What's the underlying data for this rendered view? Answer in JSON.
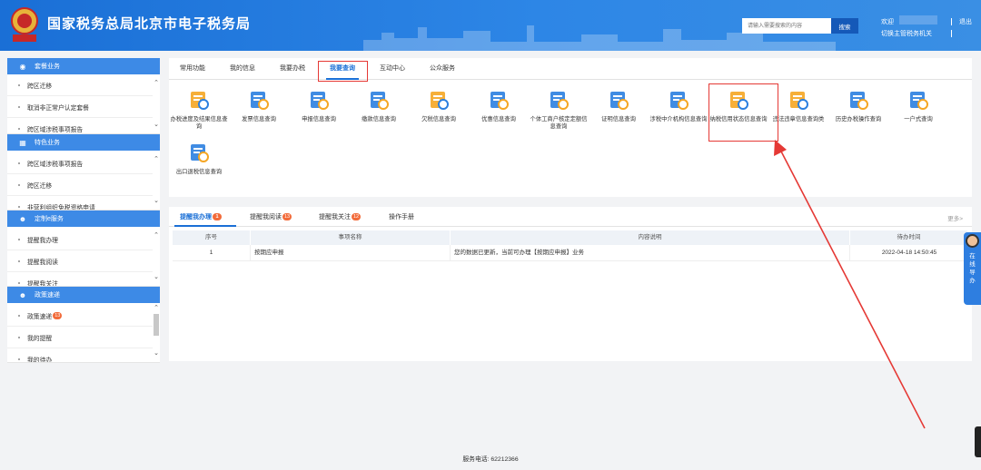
{
  "header": {
    "emblem_text": "税务总局",
    "title": "国家税务总局北京市电子税务局",
    "search_placeholder": "请输入需要搜索的内容",
    "search_button": "搜索",
    "welcome": "欢迎",
    "switch_authority": "切换主管税务机关",
    "logout": "退出"
  },
  "sidebar": {
    "sections": [
      {
        "title": "套餐业务",
        "icon": "package-icon",
        "items": [
          "跨区迁移",
          "取消非正常户认定套餐",
          "跨区域涉税事项报告"
        ]
      },
      {
        "title": "特色业务",
        "icon": "grid-icon",
        "items": [
          "跨区域涉税事项报告",
          "跨区迁移",
          "非营利组织免税资格申请"
        ]
      },
      {
        "title": "定制e服务",
        "icon": "user-icon",
        "items": [
          "提醒我办理",
          "提醒我阅读",
          "提醒我关注"
        ]
      },
      {
        "title": "政策速递",
        "icon": "user-icon",
        "items": [
          "政策速递",
          "我的提醒",
          "我的待办"
        ],
        "badge": "13"
      }
    ]
  },
  "main": {
    "tabs": [
      "常用功能",
      "我的信息",
      "我要办税",
      "我要查询",
      "互动中心",
      "公众服务"
    ],
    "active_tab": "我要查询",
    "services": [
      {
        "label": "办税进度及结果信息查询",
        "icon": "hourglass-icon",
        "color": "#f5a623"
      },
      {
        "label": "发票信息查询",
        "icon": "invoice-search-icon",
        "color": "#2b7fe0"
      },
      {
        "label": "申报信息查询",
        "icon": "declaration-icon",
        "color": "#2b7fe0"
      },
      {
        "label": "缴款信息查询",
        "icon": "money-bag-icon",
        "color": "#2b7fe0"
      },
      {
        "label": "欠税信息查询",
        "icon": "card-icon",
        "color": "#f5a623"
      },
      {
        "label": "优惠信息查询",
        "icon": "discount-icon",
        "color": "#2b7fe0"
      },
      {
        "label": "个体工商户核定定额信息查询",
        "icon": "person-doc-icon",
        "color": "#2b7fe0"
      },
      {
        "label": "证明信息查询",
        "icon": "certificate-icon",
        "color": "#2b7fe0"
      },
      {
        "label": "涉税中介机构信息查询",
        "icon": "agency-icon",
        "color": "#2b7fe0"
      },
      {
        "label": "纳税信用状态信息查询",
        "icon": "credit-medal-icon",
        "color": "#f5a623"
      },
      {
        "label": "违法违章信息查询类",
        "icon": "warning-icon",
        "color": "#f5a623"
      },
      {
        "label": "历史办税操作查询",
        "icon": "history-icon",
        "color": "#2b7fe0"
      },
      {
        "label": "一户式查询",
        "icon": "monitor-icon",
        "color": "#2b7fe0"
      },
      {
        "label": "出口退税信息查询",
        "icon": "export-refund-icon",
        "color": "#2b7fe0"
      }
    ]
  },
  "reminders": {
    "tabs": [
      {
        "label": "提醒我办理",
        "badge": "1"
      },
      {
        "label": "提醒我阅读",
        "badge": "13"
      },
      {
        "label": "提醒我关注",
        "badge": "12"
      },
      {
        "label": "操作手册",
        "badge": ""
      }
    ],
    "more": "更多>",
    "columns": [
      "序号",
      "事项名称",
      "内容说明",
      "待办时间"
    ],
    "rows": [
      {
        "no": "1",
        "name": "按期应申报",
        "desc": "您的数据已更新，当前可办理【按期应申报】业务",
        "time": "2022-04-18 14:50:45"
      }
    ]
  },
  "footer": {
    "service_phone": "服务电话: 62212366"
  },
  "online_guide": {
    "label": "在线导办"
  },
  "colors": {
    "brand_blue": "#1a6fd6",
    "sidebar_header": "#3d8ae6",
    "annotation_red": "#e53935",
    "badge_orange": "#f26b3a"
  }
}
